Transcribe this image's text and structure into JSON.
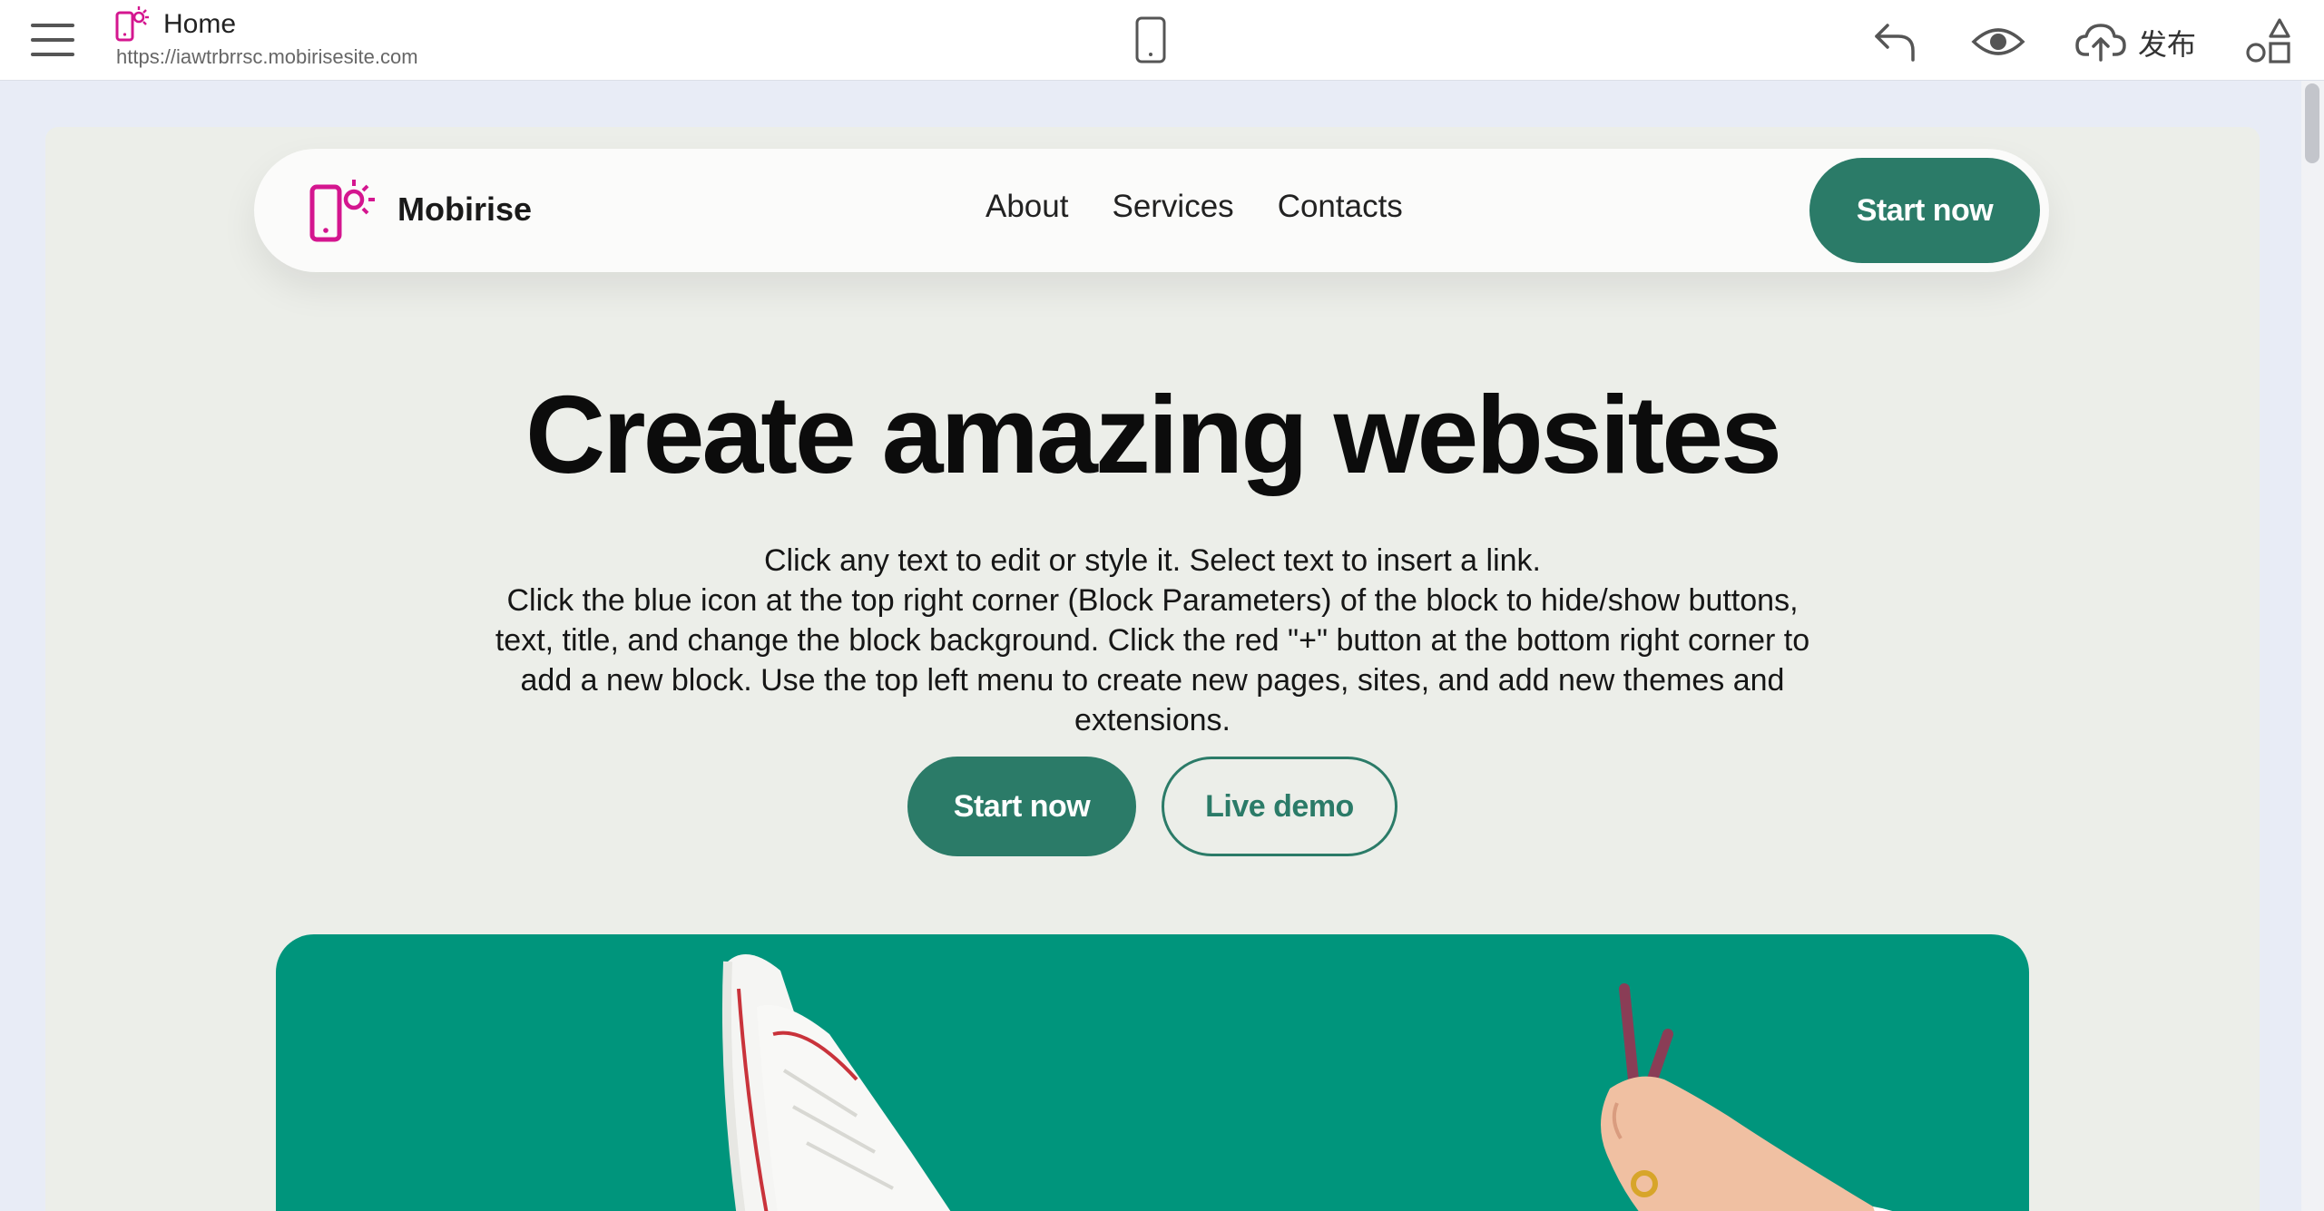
{
  "editor": {
    "page_title": "Home",
    "page_url": "https://iawtrbrrsc.mobirisesite.com",
    "publish_label": "发布",
    "icons": {
      "menu": "hamburger-menu-icon",
      "page": "page-logo-icon",
      "device": "mobile-device-icon",
      "undo": "undo-icon",
      "preview": "eye-icon",
      "publish": "cloud-upload-icon",
      "blocks": "shapes-icon"
    }
  },
  "site": {
    "brand": "Mobirise",
    "nav_links": [
      "About",
      "Services",
      "Contacts"
    ],
    "nav_cta": "Start now",
    "hero": {
      "title": "Create amazing websites",
      "text_line1": "Click any text to edit or style it. Select text to insert a link.",
      "text_line2": "Click the blue icon at the top right corner (Block Parameters) of the block to hide/show buttons, text, title, and change the block background. Click the red \"+\" button at the bottom right corner to add a new block. Use the top left menu to create new pages, sites, and add new themes and extensions.",
      "primary_button": "Start now",
      "secondary_button": "Live demo"
    }
  },
  "colors": {
    "accent": "#2b7b68",
    "brand_logo": "#d4168f",
    "canvas_bg": "#eceee9",
    "hero_image_bg": "#00957c"
  }
}
